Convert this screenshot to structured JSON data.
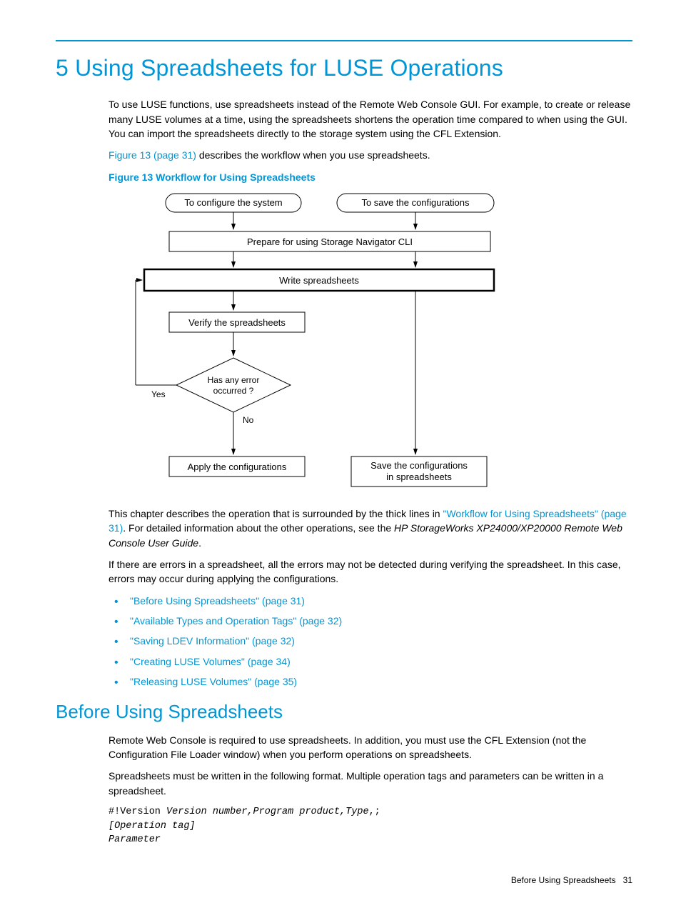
{
  "chapter": {
    "title": "5 Using Spreadsheets for LUSE Operations"
  },
  "intro": {
    "p1": "To use LUSE functions, use spreadsheets instead of the Remote Web Console GUI. For example, to create or release many LUSE volumes at a time, using the spreadsheets shortens the operation time compared to when using the GUI. You can import the spreadsheets directly to the storage system using the CFL Extension.",
    "p2_link": "Figure 13 (page 31)",
    "p2_rest": " describes the workflow when you use spreadsheets."
  },
  "figure": {
    "caption": "Figure 13 Workflow for Using Spreadsheets",
    "boxes": {
      "configure": "To configure the system",
      "save": "To save the configurations",
      "prepare": "Prepare for using Storage Navigator CLI",
      "write": "Write spreadsheets",
      "verify": "Verify the spreadsheets",
      "decision": "Has any error",
      "decision2": "occurred ?",
      "yes": "Yes",
      "no": "No",
      "apply": "Apply the configurations",
      "save_conf1": "Save the configurations",
      "save_conf2": "in spreadsheets"
    }
  },
  "after_figure": {
    "p1_a": "This chapter describes the operation that is surrounded by the thick lines in ",
    "p1_link": "\"Workflow for Using Spreadsheets\" (page 31)",
    "p1_b": ". For detailed information about the other operations, see the ",
    "p1_c_italic": "HP StorageWorks XP24000/XP20000 Remote Web Console User Guide",
    "p1_d": ".",
    "p2": "If there are errors in a spreadsheet, all the errors may not be detected during verifying the spreadsheet. In this case, errors may occur during applying the configurations."
  },
  "bullets": [
    "\"Before Using Spreadsheets\" (page 31)",
    "\"Available Types and Operation Tags\" (page 32)",
    "\"Saving LDEV Information\" (page 32)",
    "\"Creating LUSE Volumes\" (page 34)",
    "\"Releasing LUSE Volumes\" (page 35)"
  ],
  "section2": {
    "title": "Before Using Spreadsheets",
    "p1": "Remote Web Console is required to use spreadsheets. In addition, you must use the CFL Extension (not the Configuration File Loader window) when you perform operations on spreadsheets.",
    "p2": "Spreadsheets must be written in the following format. Multiple operation tags and parameters can be written in a spreadsheet.",
    "code_plain1": "#!Version ",
    "code_italic1": "Version number,Program product,Type",
    "code_plain2": ",;",
    "code_italic2": "[Operation tag]",
    "code_italic3": "Parameter"
  },
  "footer": {
    "section": "Before Using Spreadsheets",
    "page": "31"
  }
}
